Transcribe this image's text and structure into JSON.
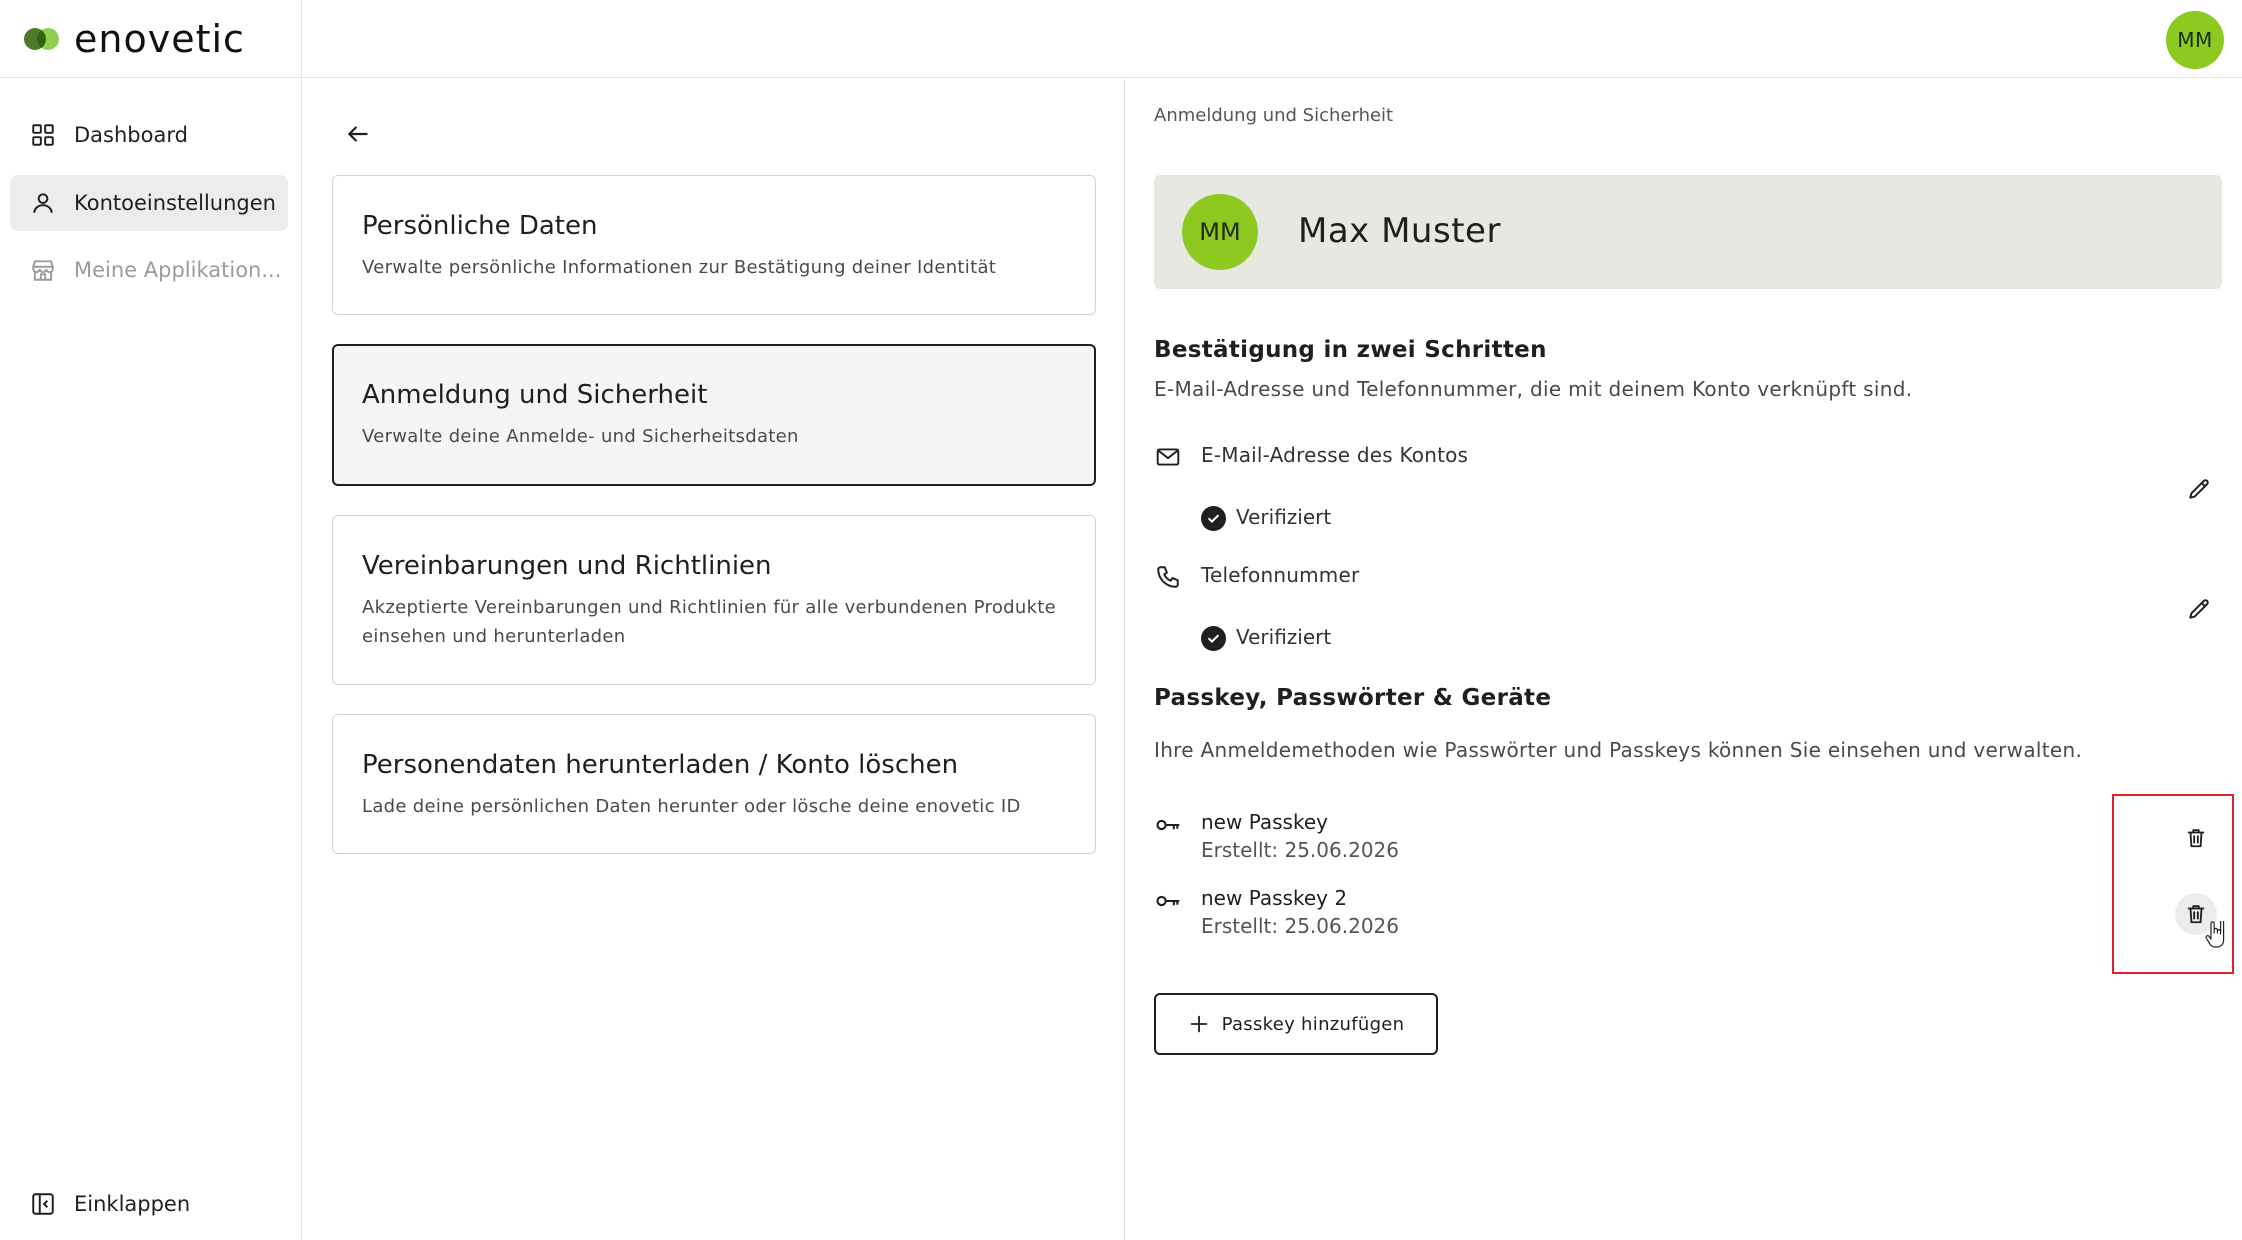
{
  "brand": {
    "name": "enovetic"
  },
  "user": {
    "initials": "MM",
    "name": "Max Muster"
  },
  "sidebar": {
    "items": [
      {
        "label": "Dashboard",
        "icon": "grid-icon"
      },
      {
        "label": "Kontoeinstellungen",
        "icon": "user-icon",
        "active": true
      },
      {
        "label": "Meine Applikation...",
        "icon": "store-icon",
        "disabled": true
      }
    ],
    "collapse_label": "Einklappen"
  },
  "settings": {
    "cards": [
      {
        "title": "Persönliche Daten",
        "desc": "Verwalte persönliche Informationen zur Bestätigung deiner Identität"
      },
      {
        "title": "Anmeldung und Sicherheit",
        "desc": "Verwalte deine Anmelde- und Sicherheitsdaten",
        "selected": true
      },
      {
        "title": "Vereinbarungen und Richtlinien",
        "desc": "Akzeptierte Vereinbarungen und Richtlinien für alle verbundenen Produkte einsehen und herunterladen"
      },
      {
        "title": "Personendaten herunterladen / Konto löschen",
        "desc": "Lade deine persönlichen Daten herunter oder lösche deine enovetic ID"
      }
    ]
  },
  "detail": {
    "breadcrumb": "Anmeldung und Sicherheit",
    "two_step": {
      "title": "Bestätigung in zwei Schritten",
      "desc": "E-Mail-Adresse und Telefonnummer, die mit deinem Konto verknüpft sind.",
      "email_label": "E-Mail-Adresse des Kontos",
      "phone_label": "Telefonnummer",
      "verified_label": "Verifiziert"
    },
    "passkeys": {
      "title": "Passkey, Passwörter & Geräte",
      "desc": "Ihre Anmeldemethoden wie Passwörter und Passkeys können Sie einsehen und verwalten.",
      "items": [
        {
          "name": "new Passkey",
          "created": "Erstellt: 25.06.2026"
        },
        {
          "name": "new Passkey 2",
          "created": "Erstellt: 25.06.2026"
        }
      ],
      "add_label": "Passkey hinzufügen"
    }
  },
  "colors": {
    "accent": "#8dc920",
    "highlight": "#e0242c",
    "profile_bg": "#e7e8e2"
  }
}
